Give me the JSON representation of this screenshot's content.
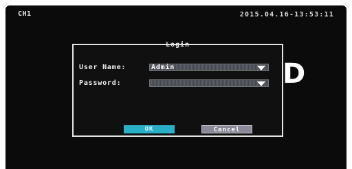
{
  "osd": {
    "channel": "CH1",
    "datetime": "2015.04.16-13:53:11"
  },
  "dialog": {
    "title": "Login",
    "username_label": "User Name:",
    "username_value": "Admin",
    "password_label": "Password:",
    "password_value": "",
    "ok_label": "OK",
    "cancel_label": "Cancel"
  },
  "colors": {
    "ok_button": "#2ab0c6",
    "cancel_button": "#8a8a98",
    "screen_background": "#0b0b0b"
  }
}
